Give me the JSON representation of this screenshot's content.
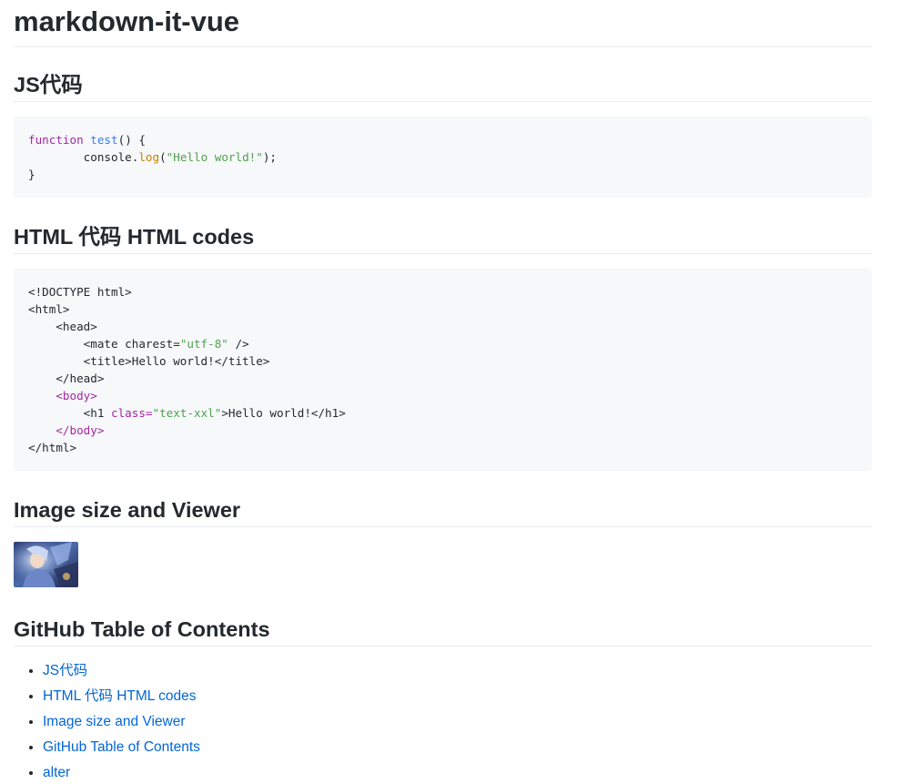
{
  "page": {
    "title": "markdown-it-vue"
  },
  "sections": {
    "js": {
      "heading": "JS代码"
    },
    "html": {
      "heading": "HTML 代码 HTML codes"
    },
    "image": {
      "heading": "Image size and Viewer"
    },
    "toc": {
      "heading": "GitHub Table of Contents"
    }
  },
  "code_js": {
    "line1_kw": "function",
    "line1_fn": "test",
    "line1_rest": "() {",
    "line2_indent": "        console.",
    "line2_method": "log",
    "line2_open": "(",
    "line2_str": "\"Hello world!\"",
    "line2_close": ");",
    "line3": "}"
  },
  "code_html": {
    "l1": "<!DOCTYPE html>",
    "l2": "<html>",
    "l3": "    <head>",
    "l4_pre": "        <mate charest=",
    "l4_str": "\"utf-8\"",
    "l4_post": " />",
    "l5": "        <title>Hello world!</title>",
    "l6": "    </head>",
    "l7_pre": "    ",
    "l7_tag": "<body>",
    "l8_pre": "        <h1 ",
    "l8_attr": "class=",
    "l8_str": "\"text-xxl\"",
    "l8_post": ">Hello world!</h1>",
    "l9_pre": "    ",
    "l9_tag": "</body>",
    "l10": "</html>"
  },
  "toc": {
    "items": [
      "JS代码",
      "HTML 代码 HTML codes",
      "Image size and Viewer",
      "GitHub Table of Contents",
      "alter"
    ]
  },
  "colors": {
    "link": "#0366d6",
    "code_bg": "#f6f8fa",
    "keyword": "#a626a4",
    "function": "#4078f2",
    "string": "#50a14f"
  }
}
